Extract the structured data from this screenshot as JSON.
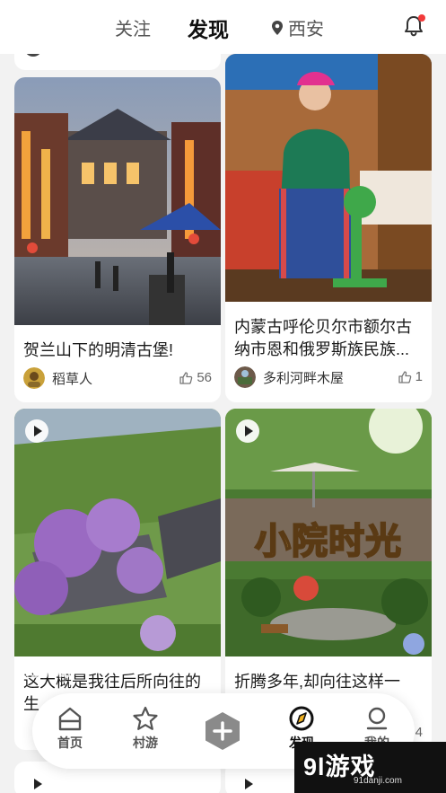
{
  "header": {
    "tab_follow": "关注",
    "tab_discover": "发现",
    "city": "西安",
    "location_icon": "location-pin-icon",
    "bell_icon": "bell-icon",
    "notification_dot_color": "#f23a3a"
  },
  "feed": {
    "cards": [
      {
        "title": "贺兰山下的明清古堡!",
        "author": "稻草人",
        "likes": "56",
        "video": false
      },
      {
        "title": "内蒙古呼伦贝尔市额尔古纳市恩和俄罗斯族民族...",
        "author": "多利河畔木屋",
        "likes": "1",
        "video": false
      },
      {
        "title": "这大概是我往后所向往的生",
        "author": "",
        "likes": "",
        "video": true
      },
      {
        "title": "折腾多年,却向往这样一",
        "overlay_text": "小院时光",
        "author": "",
        "likes": "4",
        "video": true
      }
    ]
  },
  "navbar": {
    "home": "首页",
    "village": "村游",
    "discover": "发现",
    "mine": "我的",
    "plus_icon": "add-post-icon"
  },
  "watermark": {
    "logo": "9l游戏",
    "site": "91danji.com",
    "faint": "9l游戏"
  }
}
